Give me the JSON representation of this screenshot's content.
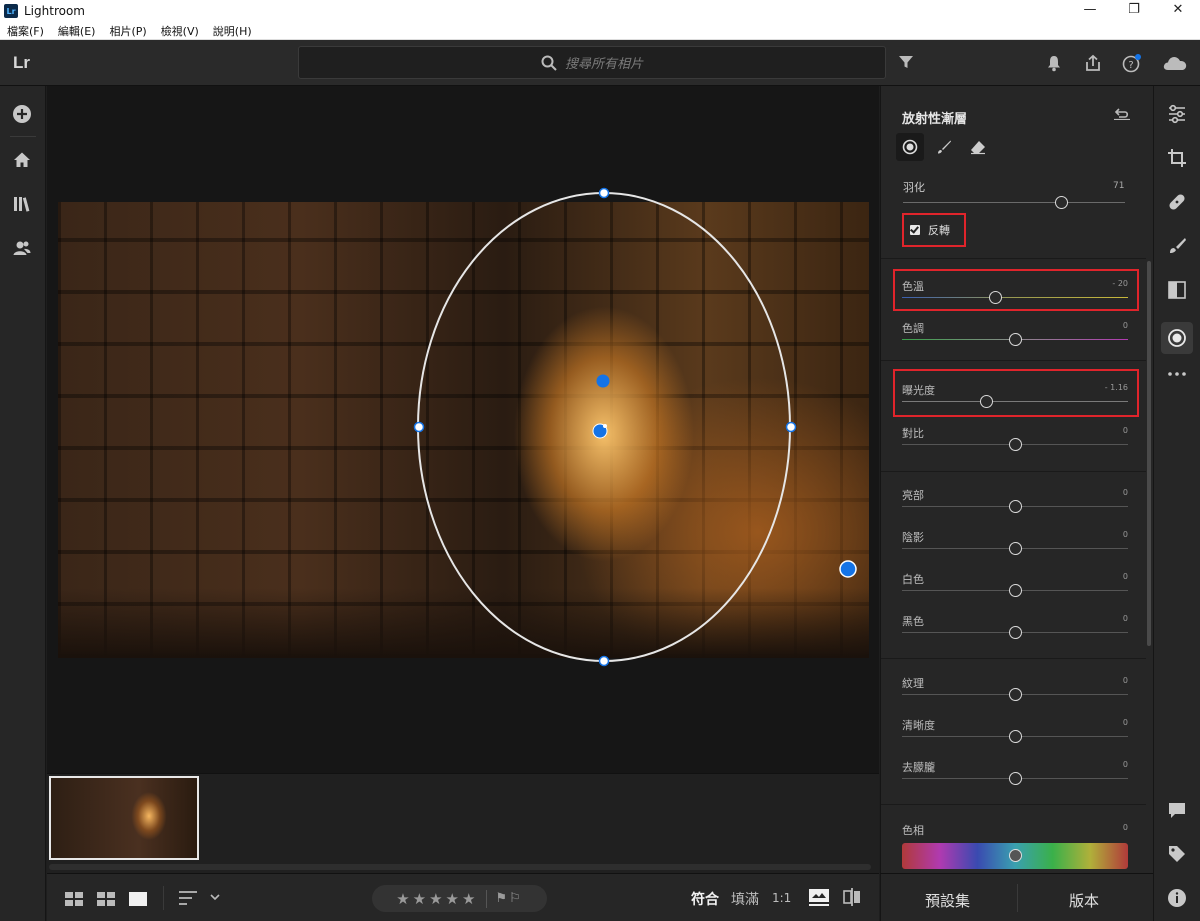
{
  "window": {
    "title": "Lightroom",
    "logo": "Lr",
    "controls": [
      "—",
      "❐",
      "✕"
    ]
  },
  "menu": [
    "檔案(F)",
    "編輯(E)",
    "相片(P)",
    "檢視(V)",
    "說明(H)"
  ],
  "topbar": {
    "brand": "Lr",
    "search_placeholder": "搜尋所有相片"
  },
  "panel": {
    "title": "放射性漸層",
    "feather": {
      "label": "羽化",
      "value": "71",
      "level": 0.71
    },
    "invert": {
      "label": "反轉",
      "checked": true
    },
    "group1": [
      {
        "label": "色溫",
        "value": "- 20",
        "level": 0.41,
        "highlight": true
      },
      {
        "label": "色調",
        "value": "0",
        "level": 0.5
      }
    ],
    "group2": [
      {
        "label": "曝光度",
        "value": "- 1.16",
        "level": 0.37,
        "highlight": true
      },
      {
        "label": "對比",
        "value": "0",
        "level": 0.5
      }
    ],
    "group3": [
      {
        "label": "亮部",
        "value": "0",
        "level": 0.5
      },
      {
        "label": "陰影",
        "value": "0",
        "level": 0.5
      },
      {
        "label": "白色",
        "value": "0",
        "level": 0.5
      },
      {
        "label": "黑色",
        "value": "0",
        "level": 0.5
      }
    ],
    "group4": [
      {
        "label": "紋理",
        "value": "0",
        "level": 0.5
      },
      {
        "label": "清晰度",
        "value": "0",
        "level": 0.5
      },
      {
        "label": "去朦朧",
        "value": "0",
        "level": 0.5
      }
    ],
    "hue": {
      "label": "色相",
      "value": "0",
      "level": 0.5
    }
  },
  "bottombar": {
    "fit": "符合",
    "fill": "填滿",
    "one_to_one": "1:1",
    "stars": "★★★★★",
    "flags": "⚑⚐"
  },
  "panel_bottom": {
    "presets": "預設集",
    "versions": "版本"
  },
  "colors": {
    "accent": "#1473e6",
    "highlight": "#e0242b",
    "bg": "#1e1e1e"
  }
}
